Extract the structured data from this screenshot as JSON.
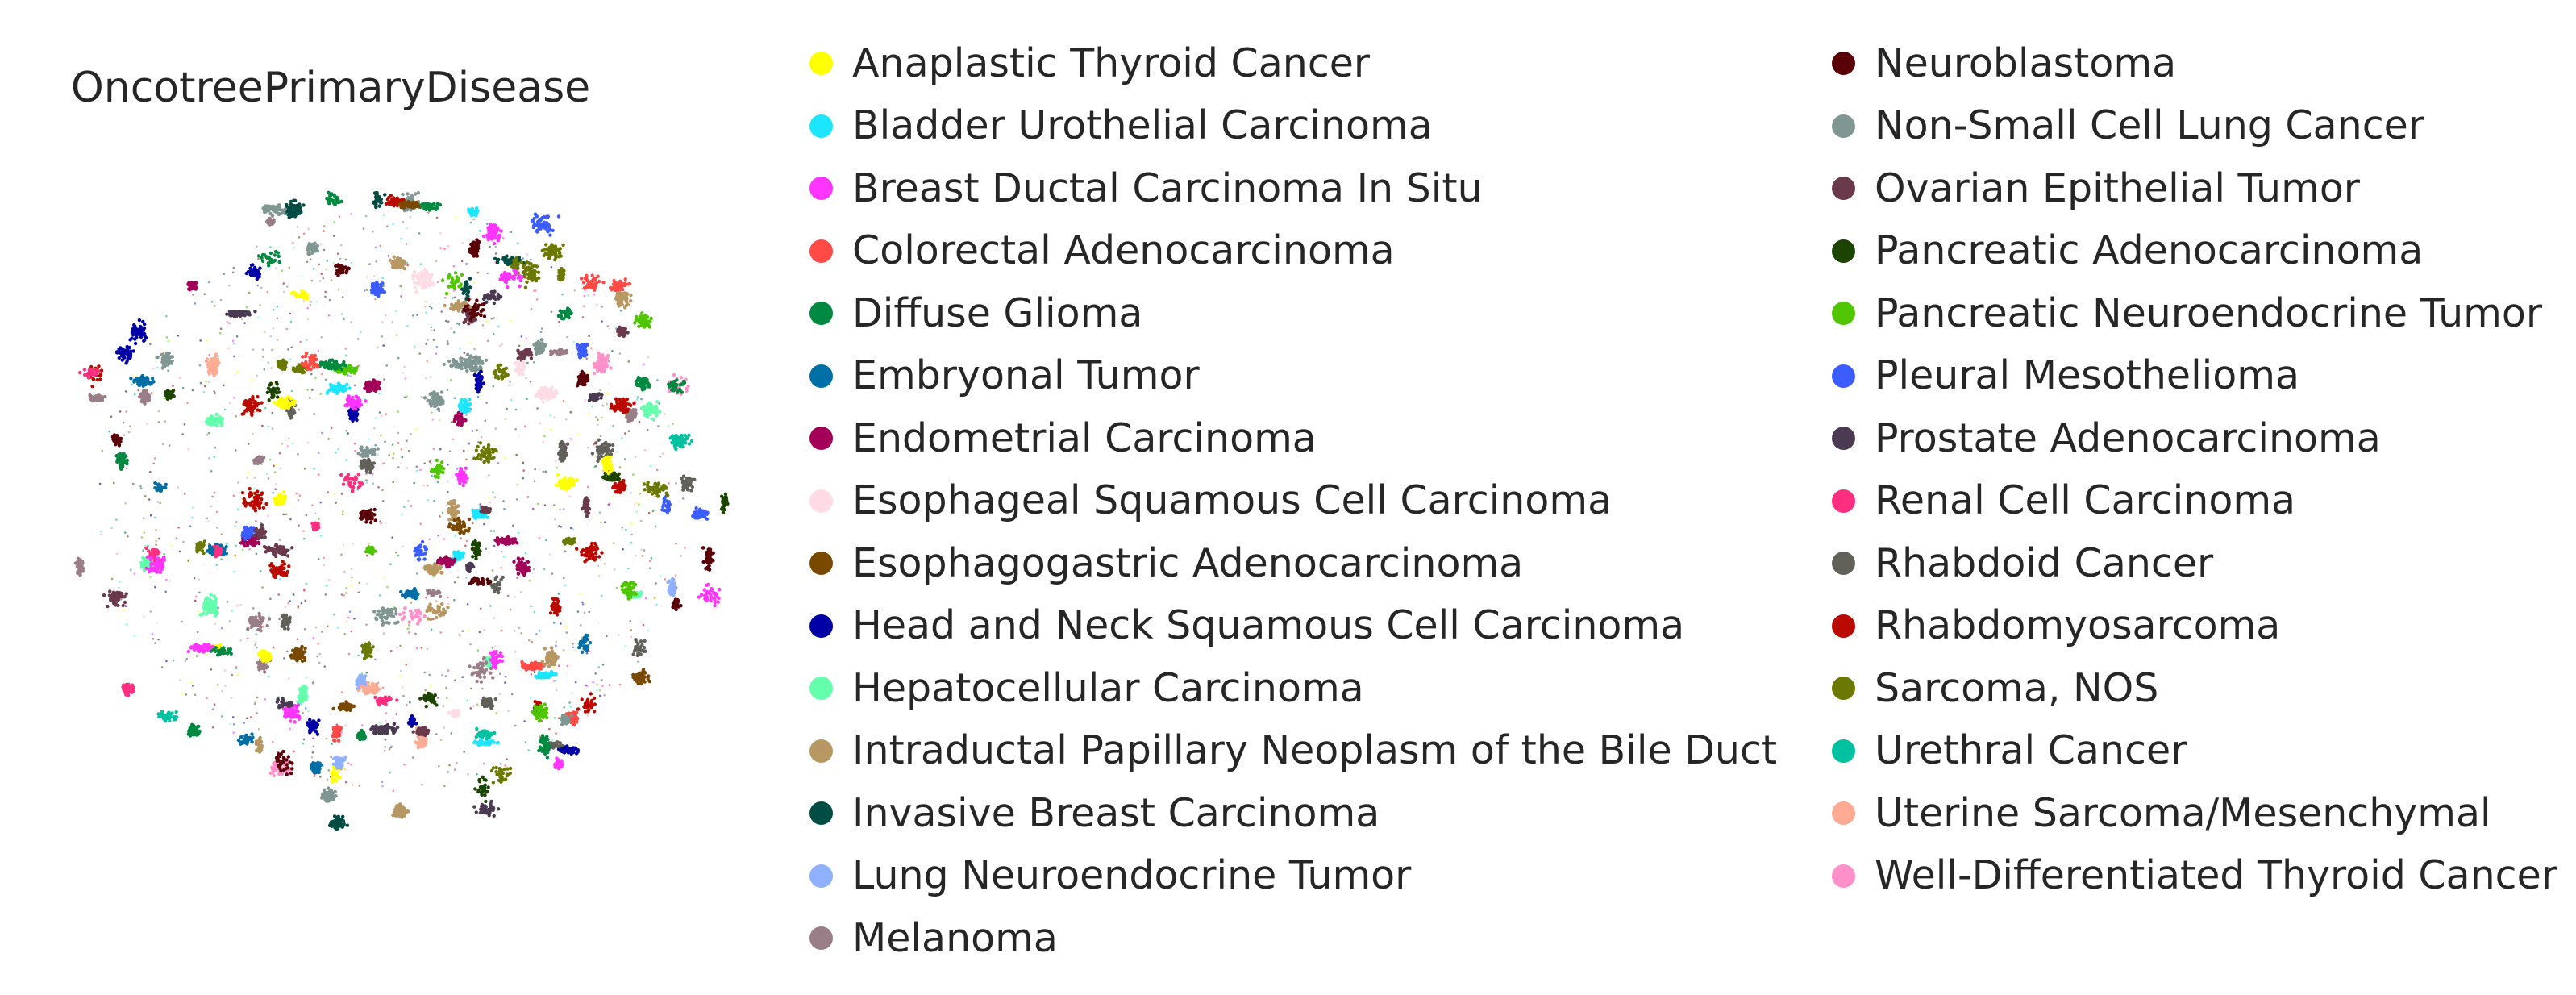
{
  "chart_data": {
    "type": "scatter",
    "title": "OncotreePrimaryDisease",
    "xlabel": "",
    "ylabel": "",
    "grid": false,
    "legend_placement": "right, two columns",
    "series": [
      {
        "name": "Anaplastic Thyroid Cancer",
        "color": "#ffff00"
      },
      {
        "name": "Bladder Urothelial Carcinoma",
        "color": "#1ce6ff"
      },
      {
        "name": "Breast Ductal Carcinoma In Situ",
        "color": "#ff34ff"
      },
      {
        "name": "Colorectal Adenocarcinoma",
        "color": "#ff4a46"
      },
      {
        "name": "Diffuse Glioma",
        "color": "#008941"
      },
      {
        "name": "Embryonal Tumor",
        "color": "#006fa6"
      },
      {
        "name": "Endometrial Carcinoma",
        "color": "#a30059"
      },
      {
        "name": "Esophageal Squamous Cell Carcinoma",
        "color": "#ffdbe5"
      },
      {
        "name": "Esophagogastric Adenocarcinoma",
        "color": "#7a4900"
      },
      {
        "name": "Head and Neck Squamous Cell Carcinoma",
        "color": "#0000a6"
      },
      {
        "name": "Hepatocellular Carcinoma",
        "color": "#63ffac"
      },
      {
        "name": "Intraductal Papillary Neoplasm of the Bile Duct",
        "color": "#b79762"
      },
      {
        "name": "Invasive Breast Carcinoma",
        "color": "#004d43"
      },
      {
        "name": "Lung Neuroendocrine Tumor",
        "color": "#8fb0ff"
      },
      {
        "name": "Melanoma",
        "color": "#997d87"
      },
      {
        "name": "Neuroblastoma",
        "color": "#5a0007"
      },
      {
        "name": "Non-Small Cell Lung Cancer",
        "color": "#809693"
      },
      {
        "name": "Ovarian Epithelial Tumor",
        "color": "#6a3a4c"
      },
      {
        "name": "Pancreatic Adenocarcinoma",
        "color": "#1b4400"
      },
      {
        "name": "Pancreatic Neuroendocrine Tumor",
        "color": "#4fc601"
      },
      {
        "name": "Pleural Mesothelioma",
        "color": "#3b5dff"
      },
      {
        "name": "Prostate Adenocarcinoma",
        "color": "#4a3b53"
      },
      {
        "name": "Renal Cell Carcinoma",
        "color": "#ff2f80"
      },
      {
        "name": "Rhabdoid Cancer",
        "color": "#61615a"
      },
      {
        "name": "Rhabdomyosarcoma",
        "color": "#ba0900"
      },
      {
        "name": "Sarcoma, NOS",
        "color": "#6b7900"
      },
      {
        "name": "Urethral Cancer",
        "color": "#00c2a0"
      },
      {
        "name": "Uterine Sarcoma/Mesenchymal",
        "color": "#ffaa92"
      },
      {
        "name": "Well-Differentiated Thyroid Cancer",
        "color": "#ff90c9"
      }
    ]
  }
}
